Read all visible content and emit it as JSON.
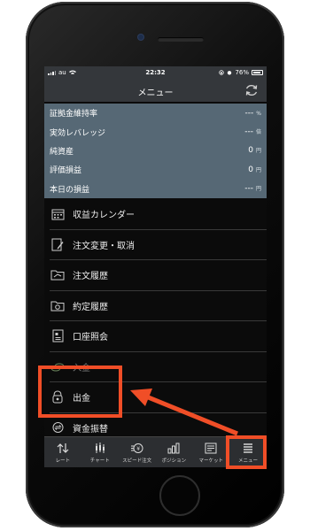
{
  "status": {
    "carrier": "au",
    "time": "22:32",
    "battery": "76%"
  },
  "header": {
    "title": "メニュー"
  },
  "summary": [
    {
      "label": "証拠金維持率",
      "value": "---",
      "unit": "%"
    },
    {
      "label": "実効レバレッジ",
      "value": "---",
      "unit": "倍"
    },
    {
      "label": "純資産",
      "value": "0",
      "unit": "円"
    },
    {
      "label": "評価損益",
      "value": "0",
      "unit": "円"
    },
    {
      "label": "本日の損益",
      "value": "---",
      "unit": "円"
    }
  ],
  "menu": [
    {
      "label": "収益カレンダー",
      "icon": "calendar-icon"
    },
    {
      "label": "注文変更・取消",
      "icon": "edit-note-icon"
    },
    {
      "label": "注文履歴",
      "icon": "folder-history-icon"
    },
    {
      "label": "約定履歴",
      "icon": "folder-check-icon"
    },
    {
      "label": "口座照会",
      "icon": "account-book-icon"
    },
    {
      "label": "入金",
      "icon": "coins-icon"
    },
    {
      "label": "出金",
      "icon": "withdraw-icon"
    },
    {
      "label": "資金振替",
      "icon": "transfer-icon"
    }
  ],
  "tabs": [
    {
      "label": "レート",
      "icon": "rate-arrows-icon"
    },
    {
      "label": "チャート",
      "icon": "candlestick-icon"
    },
    {
      "label": "スピード注文",
      "icon": "speed-order-icon"
    },
    {
      "label": "ポジション",
      "icon": "position-bars-icon"
    },
    {
      "label": "マーケット",
      "icon": "market-news-icon"
    },
    {
      "label": "メニュー",
      "icon": "menu-list-icon"
    }
  ],
  "colors": {
    "highlight": "#f04e27",
    "summary_bg": "#566875",
    "header_bg": "#34373b"
  }
}
